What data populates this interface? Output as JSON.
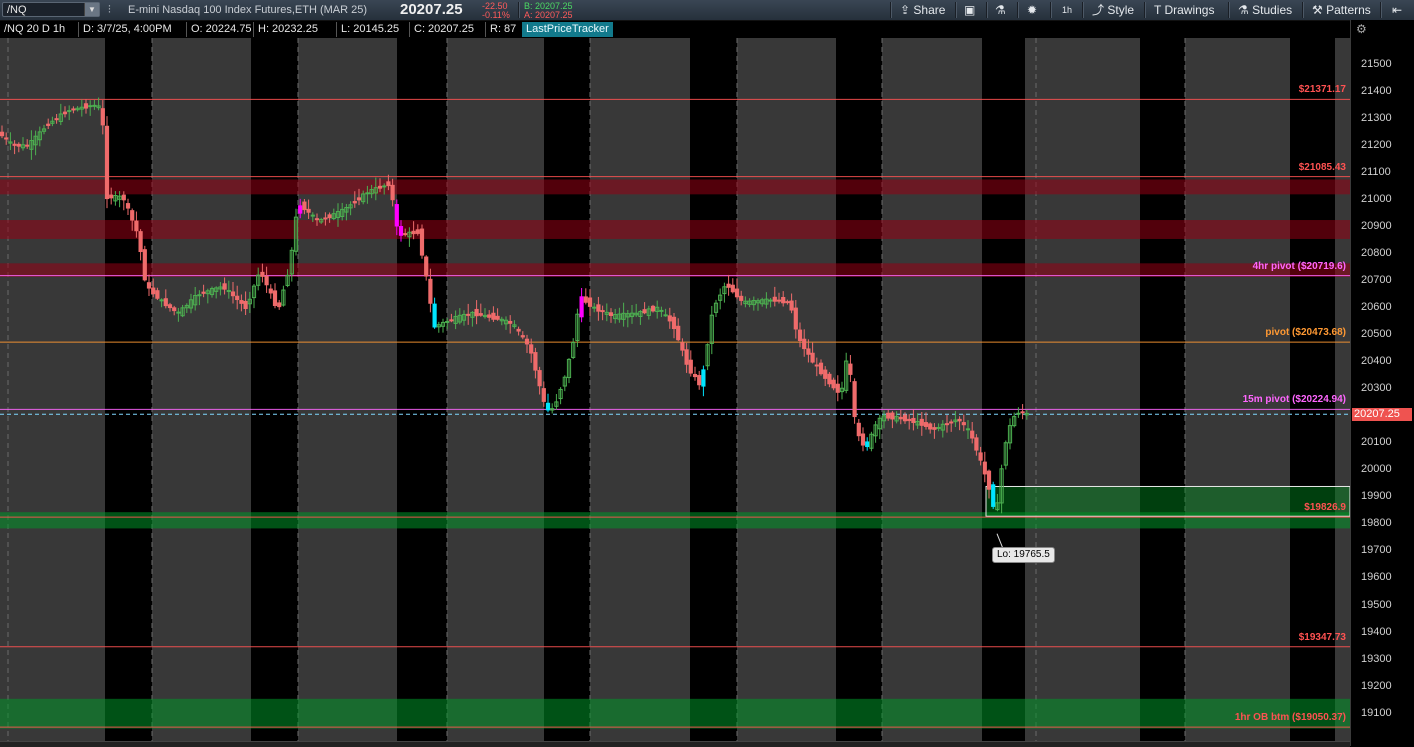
{
  "toolbar": {
    "symbol": "/NQ",
    "description": "E-mini Nasdaq 100 Index Futures,ETH (MAR 25)",
    "last": "20207.25",
    "net_change": "-22.50",
    "pct_change": "-0.11%",
    "bid": "B: 20207.25",
    "ask": "A: 20207.25",
    "share_label": "Share",
    "timeframe_label": "1h",
    "style_label": "Style",
    "drawings_label": "Drawings",
    "studies_label": "Studies",
    "patterns_label": "Patterns",
    "icons": [
      "dropdown-arrow-icon",
      "link-icon",
      "share-icon",
      "grid-icon",
      "flask-icon",
      "gear-icon",
      "style-icon",
      "drawings-icon",
      "studies-icon",
      "patterns-icon",
      "collapse-icon"
    ]
  },
  "info": {
    "symbol_period": "/NQ 20 D 1h",
    "date": "D: 3/7/25, 4:00PM",
    "open": "O: 20224.75",
    "high": "H: 20232.25",
    "low": "L: 20145.25",
    "close": "C: 20207.25",
    "range": "R: 87",
    "study": "LastPriceTracker"
  },
  "axis": {
    "ticks": [
      "21500",
      "21400",
      "21300",
      "21200",
      "21100",
      "21000",
      "20900",
      "20800",
      "20700",
      "20600",
      "20500",
      "20400",
      "20300",
      "20200",
      "20100",
      "20000",
      "19900",
      "19800",
      "19700",
      "19600",
      "19500",
      "19400",
      "19300",
      "19200",
      "19100"
    ],
    "last_price": "20207.25"
  },
  "levels": [
    {
      "label": "$21371.17",
      "price": 21371.17,
      "color": "#ff5252"
    },
    {
      "label": "$21085.43",
      "price": 21085.43,
      "color": "#ff5252"
    },
    {
      "label": "4hr pivot ($20719.6)",
      "price": 20719.6,
      "color": "#ff66ff"
    },
    {
      "label": "pivot ($20473.68)",
      "price": 20473.68,
      "color": "#ff9933"
    },
    {
      "label": "15m pivot ($20224.94)",
      "price": 20224.94,
      "color": "#ff66ff"
    },
    {
      "label": "$19826.9",
      "price": 19826.9,
      "color": "#ff5252"
    },
    {
      "label": "$19347.73",
      "price": 19347.73,
      "color": "#ff5252"
    },
    {
      "label": "1hr OB btm ($19050.37)",
      "price": 19050.37,
      "color": "#ff5252"
    }
  ],
  "low_marker": "Lo: 19765.5",
  "colors": {
    "up": "#4caf50",
    "down": "#ef6b6b",
    "highlight": "#ff00ff",
    "cyan": "#00e5ff"
  }
}
